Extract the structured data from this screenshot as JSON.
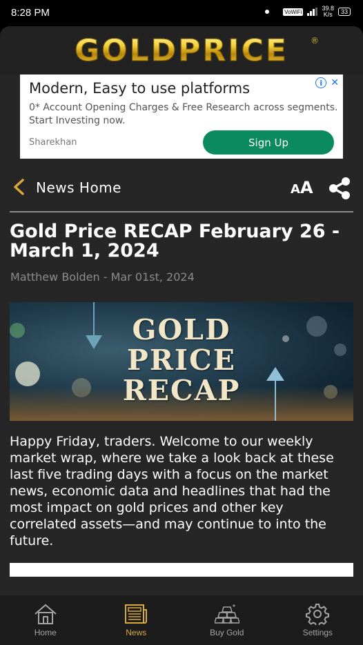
{
  "status_bar": {
    "time": "8:28 PM",
    "vowifi": "VoWiFi",
    "net_speed_value": "39.8",
    "net_speed_unit": "K/s",
    "battery": "33"
  },
  "header": {
    "logo_text": "GOLDPRICE",
    "registered_mark": "®"
  },
  "ad": {
    "title": "Modern, Easy to use platforms",
    "description": "0* Account Opening Charges & Free Research across segments. Start Investing now.",
    "brand": "Sharekhan",
    "cta_label": "Sign Up",
    "info_icon": "i",
    "close_icon": "✕"
  },
  "nav": {
    "back_label": "News Home",
    "font_size_small": "A",
    "font_size_large": "A"
  },
  "article": {
    "headline": "Gold Price RECAP February 26 - March 1, 2024",
    "byline": "Matthew Bolden - Mar 01st, 2024",
    "hero_text_line1": "GOLD",
    "hero_text_line2": "PRICE",
    "hero_text_line3": "RECAP",
    "body": "Happy Friday, traders. Welcome to our weekly market wrap, where we take a look back at these last five trading days with a focus on the market news, economic data and headlines that had the most impact on gold prices and other key correlated assets—and may continue to into the future."
  },
  "bottom_nav": {
    "tabs": [
      {
        "label": "Home",
        "icon": "home-icon",
        "active": false
      },
      {
        "label": "News",
        "icon": "news-icon",
        "active": true
      },
      {
        "label": "Buy Gold",
        "icon": "gold-bars-icon",
        "active": false
      },
      {
        "label": "Settings",
        "icon": "gear-icon",
        "active": false
      }
    ]
  },
  "colors": {
    "accent_gold": "#d9a93a",
    "ad_button": "#0b8a5f",
    "background": "#262626"
  }
}
